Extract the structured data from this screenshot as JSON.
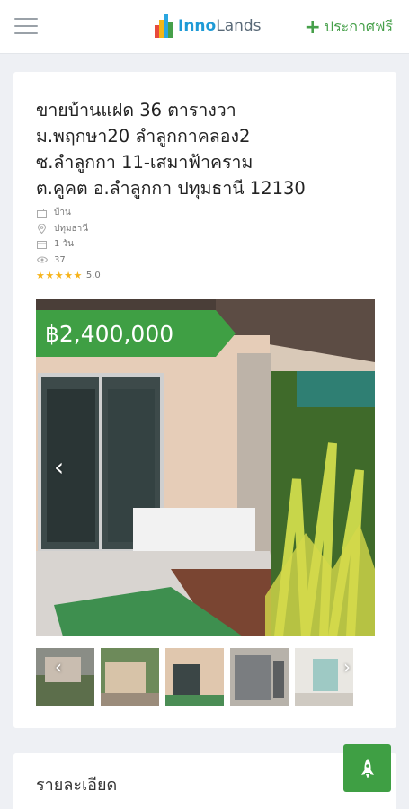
{
  "header": {
    "logo_inno": "Inno",
    "logo_lands": "Lands",
    "post_label": "ประกาศฟรี"
  },
  "listing": {
    "title_lines": [
      "ขายบ้านแฝด 36 ตารางวา",
      "ม.พฤกษา20 ลำลูกกาคลอง2",
      "ซ.ลำลูกกา 11-เสมาฟ้าคราม",
      "ต.คูคต อ.ลำลูกกา ปทุมธานี 12130"
    ],
    "type": "บ้าน",
    "province": "ปทุมธานี",
    "posted": "1 วัน",
    "views": "37",
    "rating_stars": "★★★★★",
    "rating": "5.0",
    "price": "฿2,400,000"
  },
  "gallery": {
    "prev_label": "‹",
    "next_label": "›",
    "thumb_count": 5
  },
  "details": {
    "title": "รายละเอียด"
  },
  "colors": {
    "accent_green": "#3f9f44",
    "brand_blue": "#1e9ad6"
  }
}
